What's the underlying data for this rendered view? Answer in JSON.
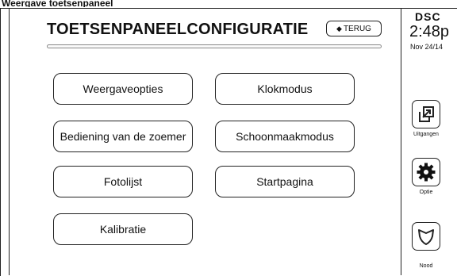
{
  "caption": "Weergave toetsenpaneel",
  "header": {
    "title": "TOETSENPANEELCONFIGURATIE",
    "back_label": "TERUG"
  },
  "options": [
    {
      "id": "weergaveopties",
      "label": "Weergaveopties"
    },
    {
      "id": "klokmodus",
      "label": "Klokmodus"
    },
    {
      "id": "bediening-zoemer",
      "label": "Bediening van de zoemer"
    },
    {
      "id": "schoonmaakmodus",
      "label": "Schoonmaakmodus"
    },
    {
      "id": "fotolijst",
      "label": "Fotolijst"
    },
    {
      "id": "startpagina",
      "label": "Startpagina"
    },
    {
      "id": "kalibratie",
      "label": "Kalibratie"
    }
  ],
  "sidebar": {
    "brand": "DSC",
    "time": "2:48p",
    "date": "Nov 24/14",
    "buttons": [
      {
        "label": "Uitgangen",
        "icon": "exit-icon"
      },
      {
        "label": "Optie",
        "icon": "options-gear-icon"
      },
      {
        "label": "Nood",
        "icon": "emergency-shield-icon"
      }
    ]
  }
}
